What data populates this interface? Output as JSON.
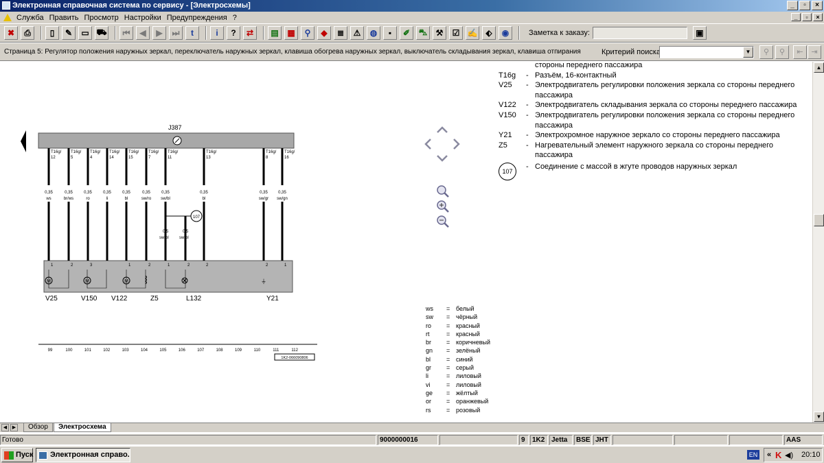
{
  "window": {
    "title": "Электронная справочная система по сервису - [Электросхемы]"
  },
  "menu": {
    "items": [
      "Служба",
      "Править",
      "Просмотр",
      "Настройки",
      "Предупреждения",
      "?"
    ]
  },
  "toolbar": {
    "order_note_label": "Заметка к заказу:",
    "order_note_value": ""
  },
  "search": {
    "page_title": "Страница 5: Регулятор положения наружных зеркал, переключатель наружных зеркал, клавиша обогрева наружных зеркал, выключатель складывания зеркал, клавиша отпирания",
    "criteria_label": "Критерий поиска:",
    "criteria_value": ""
  },
  "schematic": {
    "control_unit": "J387",
    "pins": [
      {
        "connector": "T16g/",
        "pin": "12",
        "gauge": "0,35",
        "color": "ws"
      },
      {
        "connector": "T16g/",
        "pin": "5",
        "gauge": "0,35",
        "color": "br/ws"
      },
      {
        "connector": "T16g/",
        "pin": "4",
        "gauge": "0,35",
        "color": "ro"
      },
      {
        "connector": "T16g/",
        "pin": "14",
        "gauge": "0,35",
        "color": "li"
      },
      {
        "connector": "T16g/",
        "pin": "15",
        "gauge": "0,35",
        "color": "bl"
      },
      {
        "connector": "T16g/",
        "pin": "7",
        "gauge": "0,35",
        "color": "sw/ro"
      },
      {
        "connector": "T16g/",
        "pin": "11",
        "gauge": "0,35",
        "color": "sw/bl"
      },
      {
        "connector": "T16g/",
        "pin": "13",
        "gauge": "0,35",
        "color": "bl"
      },
      {
        "connector": "T16g/",
        "pin": "8",
        "gauge": "0,35",
        "color": "sw/gr"
      },
      {
        "connector": "T16g/",
        "pin": "16",
        "gauge": "0,35",
        "color": "sw/gn"
      }
    ],
    "ground_point": "107",
    "ground_wires": [
      {
        "gauge": "0,5",
        "color": "sw/bl"
      },
      {
        "gauge": "0,5",
        "color": "sw/bl"
      }
    ],
    "component_pins": [
      "1",
      "2",
      "3",
      "1",
      "2",
      "1",
      "2",
      "2",
      "1",
      "2",
      "1"
    ],
    "components": [
      "V25",
      "V150",
      "V122",
      "Z5",
      "L132",
      "Y21"
    ],
    "motor_symbol": "M",
    "ground_symbol": "⏚",
    "tracks": [
      "99",
      "100",
      "101",
      "102",
      "103",
      "104",
      "105",
      "106",
      "107",
      "108",
      "109",
      "110",
      "111",
      "112"
    ],
    "drawing_code": "1K2-066090806"
  },
  "legend": {
    "entries": [
      {
        "code": "",
        "text": "стороны переднего пассажира"
      },
      {
        "code": "T16g",
        "text": "Разъём, 16-контактный"
      },
      {
        "code": "V25",
        "text": "Электродвигатель регулировки положения зеркала со стороны переднего пассажира"
      },
      {
        "code": "V122",
        "text": "Электродвигатель складывания зеркала со стороны переднего пассажира"
      },
      {
        "code": "V150",
        "text": "Электродвигатель регулировки положения зеркала со стороны переднего пассажира"
      },
      {
        "code": "Y21",
        "text": "Электрохромное наружное зеркало со стороны переднего пассажира"
      },
      {
        "code": "Z5",
        "text": "Нагревательный элемент наружного зеркала со стороны переднего пассажира"
      }
    ],
    "ground_code": "107",
    "ground_text": "Соединение с массой в жгуте проводов наружных зеркал"
  },
  "color_codes": [
    {
      "code": "ws",
      "name": "белый"
    },
    {
      "code": "sw",
      "name": "чёрный"
    },
    {
      "code": "ro",
      "name": "красный"
    },
    {
      "code": "rt",
      "name": "красный"
    },
    {
      "code": "br",
      "name": "коричневый"
    },
    {
      "code": "gn",
      "name": "зелёный"
    },
    {
      "code": "bl",
      "name": "синий"
    },
    {
      "code": "gr",
      "name": "серый"
    },
    {
      "code": "li",
      "name": "лиловый"
    },
    {
      "code": "vi",
      "name": "лиловый"
    },
    {
      "code": "ge",
      "name": "жёлтый"
    },
    {
      "code": "or",
      "name": "оранжевый"
    },
    {
      "code": "rs",
      "name": "розовый"
    }
  ],
  "tabs": [
    {
      "label": "Обзор"
    },
    {
      "label": "Электросхема"
    }
  ],
  "status": {
    "text": "Готово",
    "order_number": "9000000016",
    "cells": [
      "9",
      "1K2",
      "Jetta",
      "BSE",
      "JHT"
    ],
    "right": "AAS"
  },
  "taskbar": {
    "start_label": "Пуск",
    "task_label": "Электронная справо...",
    "lang": "EN",
    "clock": "20:10"
  }
}
